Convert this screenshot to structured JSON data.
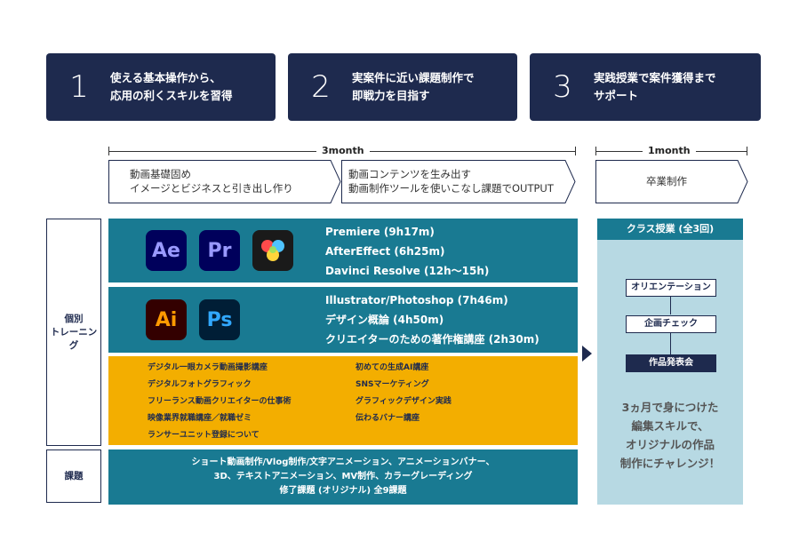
{
  "steps": [
    {
      "num": "1",
      "text": "使える基本操作から、\n応用の利くスキルを習得"
    },
    {
      "num": "2",
      "text": "実案件に近い課題制作で\n即戦力を目指す"
    },
    {
      "num": "3",
      "text": "実践授業で案件獲得まで\nサポート"
    }
  ],
  "timeline": {
    "period1": "3month",
    "period2": "1month"
  },
  "phases": [
    {
      "text": "動画基礎固め\nイメージとビジネスと引き出し作り"
    },
    {
      "text": "動画コンテンツを生み出す\n動画制作ツールを使いこなし課題でOUTPUT"
    },
    {
      "text": "卒業制作"
    }
  ],
  "side_labels": {
    "individual": "個別\nトレーニング",
    "assignment": "課題"
  },
  "apps": {
    "video": [
      {
        "abbr": "Ae",
        "icon": "after-effects-icon",
        "bg": "#00005b",
        "fg": "#9999ff"
      },
      {
        "abbr": "Pr",
        "icon": "premiere-icon",
        "bg": "#00005b",
        "fg": "#9999ff"
      },
      {
        "abbr": "",
        "icon": "davinci-resolve-icon",
        "bg": "#1a1a1a",
        "fg": "#ffffff"
      }
    ],
    "design": [
      {
        "abbr": "Ai",
        "icon": "illustrator-icon",
        "bg": "#330000",
        "fg": "#ff9a00"
      },
      {
        "abbr": "Ps",
        "icon": "photoshop-icon",
        "bg": "#001e36",
        "fg": "#31a8ff"
      }
    ]
  },
  "video_courses": [
    "Premiere (9h17m)",
    "AfterEffect (6h25m)",
    "Davinci Resolve (12h～15h)"
  ],
  "design_courses": [
    "Illustrator/Photoshop (7h46m)",
    "デザイン概論 (4h50m)",
    "クリエイターのための著作権講座 (2h30m)"
  ],
  "extra_courses_left": [
    "デジタル一眼カメラ動画撮影講座",
    "デジタルフォトグラフィック",
    "フリーランス動画クリエイターの仕事術",
    "映像業界就職講座／就職ゼミ",
    "ランサーユニット登録について"
  ],
  "extra_courses_right": [
    "初めての生成AI講座",
    "SNSマーケティング",
    "グラフィックデザイン実践",
    "伝わるバナー講座"
  ],
  "assignments": [
    "ショート動画制作/Vlog制作/文字アニメーション、アニメーションバナー、",
    "3D、テキストアニメーション、MV制作、カラーグレーディング",
    "修了課題 (オリジナル) 全9課題"
  ],
  "class": {
    "header": "クラス授業 (全3回)",
    "steps": [
      "オリエンテーション",
      "企画チェック",
      "作品発表会"
    ],
    "summary": "3ヵ月で身につけた\n編集スキルで、\nオリジナルの作品\n制作にチャレンジ！"
  },
  "colors": {
    "navy": "#1e2a4e",
    "teal": "#197a92",
    "yellow": "#f3ae00",
    "light_blue": "#b7d9e3"
  }
}
